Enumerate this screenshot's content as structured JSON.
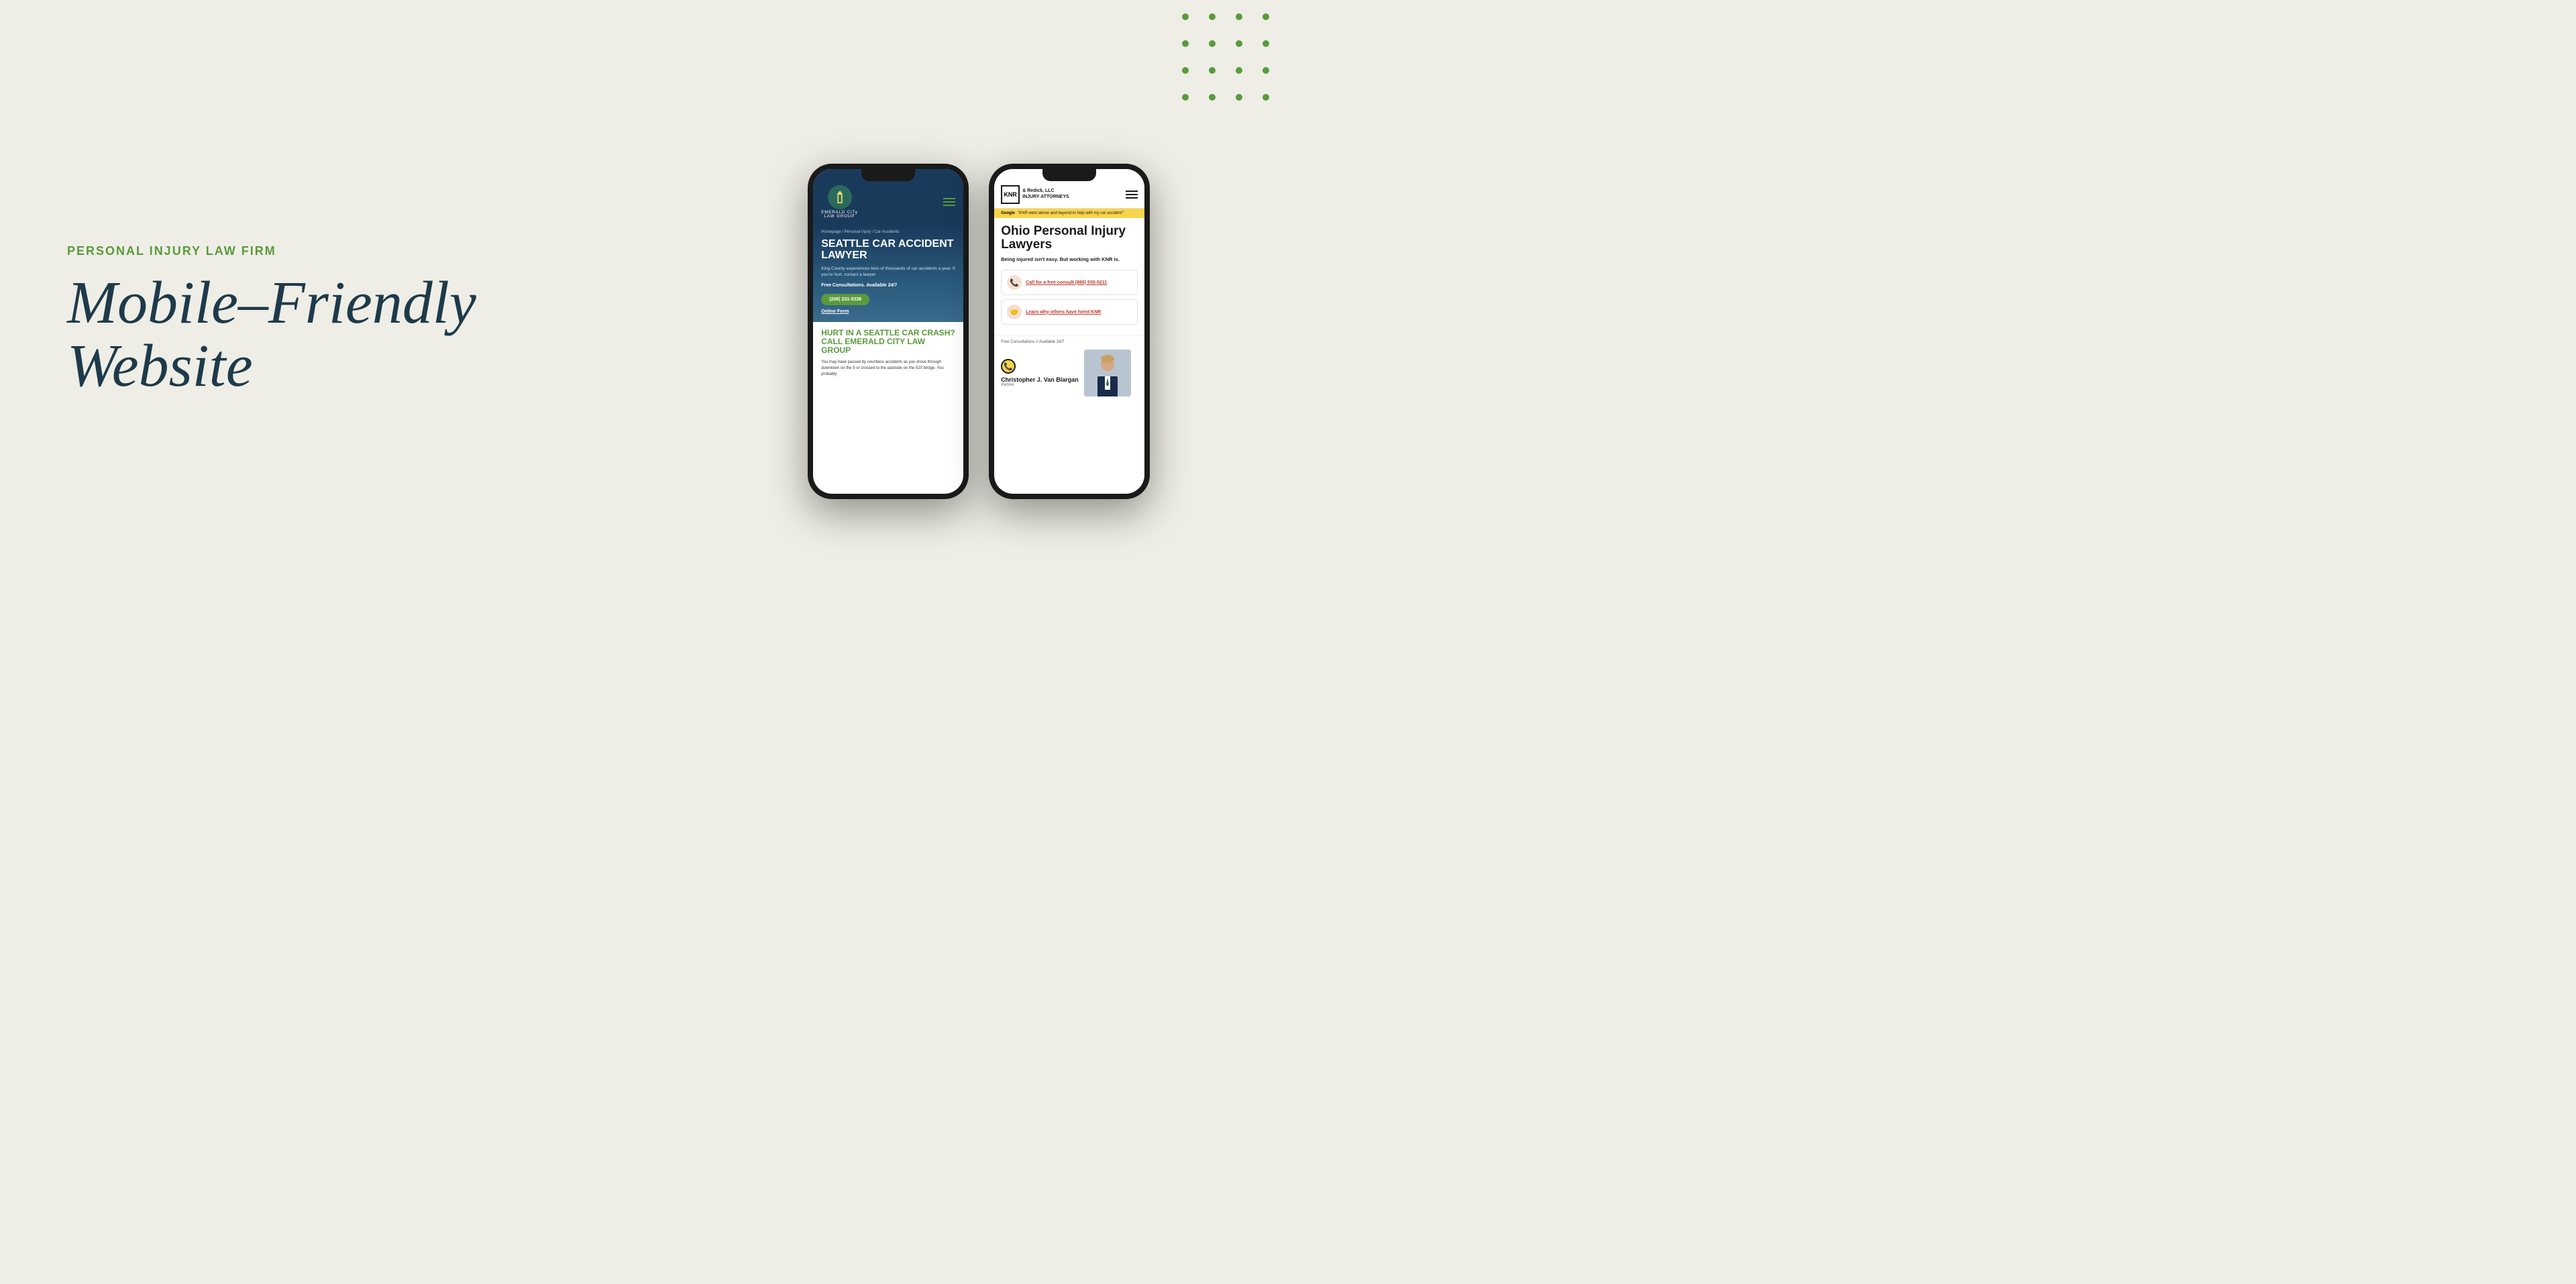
{
  "page": {
    "background_color": "#eeeee6"
  },
  "left": {
    "category_label": "PERSONAL INJURY LAW FIRM",
    "heading_line1": "Mobile–Friendly",
    "heading_line2": "Website"
  },
  "phone1": {
    "logo_text_line1": "EMERALD CiTy",
    "logo_text_line2": "LAW GROUP",
    "breadcrumb": "Homepage / Personal Injury / Car Accidents",
    "hero_title": "SEATTLE CAR ACCIDENT LAWYER",
    "hero_subtitle": "King County experiences tens of thousands of car accidents a year. If you're hurt, contact a lawyer.",
    "free_consult": "Free Consultations. Available 24/7",
    "cta_phone": "(206) 231-5338",
    "online_form": "Online Form",
    "section2_title": "HURT IN A SEATTLE CAR CRASH? CALL EMERALD CITY LAW GROUP",
    "section2_text": "You may have passed by countless accidents as you drove through downtown on the 5 or crossed to the eastside on the 520 bridge. You probably"
  },
  "phone2": {
    "logo_text_line1": "& Redick, LLC",
    "logo_text_line2": "INJURY ATTORNEYS",
    "google_label": "Google",
    "google_review": "\"KNR went above and beyond to help with my car accident\"",
    "hero_title": "Ohio Personal Injury Lawyers",
    "hero_subtitle": "Being injured isn't easy. But working with KNR is.",
    "cta1_text": "Call for a free consult (888) 530-5211",
    "cta2_text": "Learn why others have hired KNR",
    "free_consult": "Free Consultations // Available 24/7",
    "partner_name": "Christopher J. Van Blargan",
    "partner_role": "Partner"
  },
  "dots": {
    "color": "#5a9a3c",
    "count": 16
  }
}
